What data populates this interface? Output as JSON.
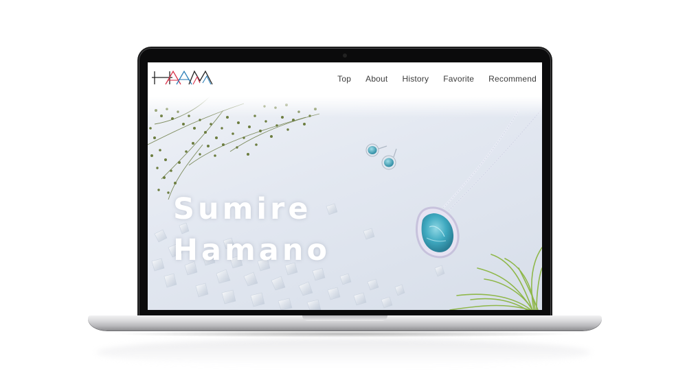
{
  "site": {
    "logo_alt": "HAM",
    "nav": [
      {
        "label": "Top"
      },
      {
        "label": "About"
      },
      {
        "label": "History"
      },
      {
        "label": "Favorite"
      },
      {
        "label": "Recommend"
      }
    ]
  },
  "hero": {
    "title_line1": "Sumire",
    "title_line2": "Hamano"
  },
  "colors": {
    "logo_dark": "#222222",
    "logo_red": "#d8324a",
    "logo_blue": "#2c7fb8",
    "title_text": "#ffffff",
    "nav_text": "#3a3a3a",
    "larimar": "#49b4c9"
  },
  "icons": {
    "logo": "ham-logo"
  }
}
